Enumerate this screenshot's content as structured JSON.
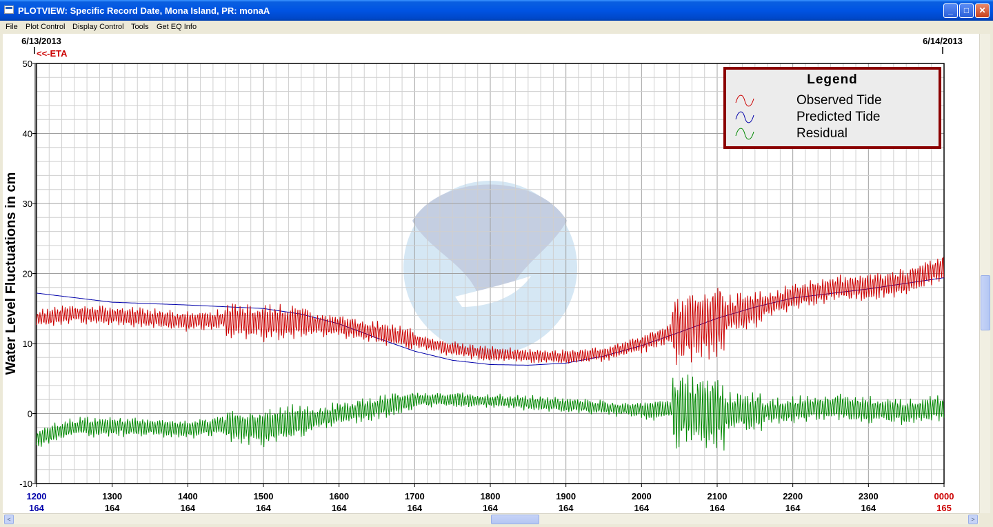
{
  "window": {
    "title": "PLOTVIEW: Specific Record Date, Mona Island, PR: monaA",
    "minimize_glyph": "_",
    "maximize_glyph": "□",
    "close_glyph": "✕",
    "icon": "app-window-icon"
  },
  "menu": {
    "items": [
      "File",
      "Plot Control",
      "Display Control",
      "Tools",
      "Get EQ Info"
    ]
  },
  "header": {
    "left_date": "6/13/2013",
    "right_date": "6/14/2013",
    "eta_marker": "<<-ETA"
  },
  "colors": {
    "observed": "#cc0000",
    "predicted": "#0000aa",
    "residual": "#008800",
    "legend_border": "#8b0000",
    "start_tick": "#0000aa",
    "end_tick": "#cc0000"
  },
  "legend": {
    "title": "Legend",
    "entries": [
      "Observed Tide",
      "Predicted Tide",
      "Residual"
    ]
  },
  "scrollbar": {
    "left_arrow": "<",
    "right_arrow": ">"
  },
  "chart_data": {
    "type": "line",
    "ylabel": "Water Level Fluctuations in cm",
    "ylim": [
      -10,
      50
    ],
    "yticks": [
      -10,
      0,
      10,
      20,
      30,
      40,
      50
    ],
    "x_range": [
      1200,
      2400
    ],
    "x_ticks": [
      {
        "x": 1200,
        "time": "1200",
        "day": "164"
      },
      {
        "x": 1300,
        "time": "1300",
        "day": "164"
      },
      {
        "x": 1400,
        "time": "1400",
        "day": "164"
      },
      {
        "x": 1500,
        "time": "1500",
        "day": "164"
      },
      {
        "x": 1600,
        "time": "1600",
        "day": "164"
      },
      {
        "x": 1700,
        "time": "1700",
        "day": "164"
      },
      {
        "x": 1800,
        "time": "1800",
        "day": "164"
      },
      {
        "x": 1900,
        "time": "1900",
        "day": "164"
      },
      {
        "x": 2000,
        "time": "2000",
        "day": "164"
      },
      {
        "x": 2100,
        "time": "2100",
        "day": "164"
      },
      {
        "x": 2200,
        "time": "2200",
        "day": "164"
      },
      {
        "x": 2300,
        "time": "2300",
        "day": "164"
      },
      {
        "x": 2400,
        "time": "0000",
        "day": "165"
      }
    ],
    "grid": true,
    "legend_position": "top-right",
    "series": [
      {
        "name": "Predicted Tide",
        "x": [
          1200,
          1300,
          1400,
          1500,
          1550,
          1600,
          1650,
          1700,
          1750,
          1800,
          1850,
          1900,
          1950,
          2000,
          2050,
          2100,
          2150,
          2200,
          2300,
          2400
        ],
        "values": [
          17.2,
          15.9,
          15.5,
          15.0,
          14.2,
          12.8,
          10.8,
          8.9,
          7.6,
          7.0,
          6.9,
          7.2,
          8.2,
          9.7,
          11.6,
          13.6,
          15.2,
          16.5,
          17.8,
          19.4
        ]
      },
      {
        "name": "Observed Tide",
        "x": [
          1200,
          1250,
          1300,
          1350,
          1400,
          1450,
          1500,
          1550,
          1600,
          1650,
          1700,
          1750,
          1800,
          1850,
          1900,
          1950,
          2000,
          2050,
          2075,
          2100,
          2150,
          2200,
          2250,
          2300,
          2350,
          2400
        ],
        "values": [
          13.5,
          14.2,
          14.0,
          13.6,
          13.2,
          13.4,
          13.0,
          13.0,
          12.5,
          11.6,
          10.5,
          9.2,
          8.5,
          8.3,
          8.0,
          8.5,
          10.0,
          12.0,
          13.0,
          13.5,
          15.0,
          16.6,
          17.8,
          18.0,
          18.8,
          21.0
        ]
      },
      {
        "name": "Residual",
        "x": [
          1200,
          1250,
          1300,
          1350,
          1400,
          1450,
          1500,
          1550,
          1600,
          1650,
          1700,
          1750,
          1800,
          1850,
          1900,
          1950,
          2000,
          2050,
          2075,
          2100,
          2150,
          2200,
          2250,
          2300,
          2350,
          2400
        ],
        "values": [
          -3.5,
          -2.0,
          -1.8,
          -2.0,
          -2.2,
          -1.7,
          -2.0,
          -1.2,
          0.0,
          0.8,
          2.0,
          2.0,
          1.8,
          1.5,
          1.2,
          0.8,
          0.5,
          0.5,
          0.3,
          0.0,
          0.3,
          0.5,
          1.0,
          0.5,
          0.3,
          0.8
        ]
      }
    ]
  }
}
